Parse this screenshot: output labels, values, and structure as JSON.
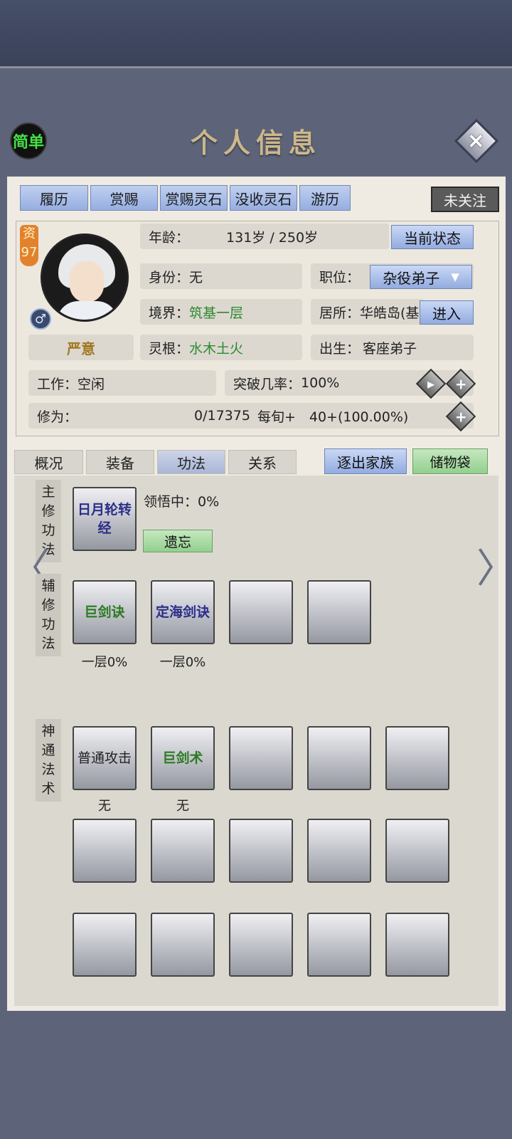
{
  "header": {
    "title": "个人信息",
    "simple_label": "简单",
    "close_icon": "×"
  },
  "top_tabs": [
    "履历",
    "赏赐",
    "赏赐灵石",
    "没收灵石",
    "游历"
  ],
  "follow_label": "未关注",
  "character": {
    "aptitude_label": "资",
    "aptitude_value": "97",
    "gender_symbol": "♂",
    "name": "严意",
    "age_label": "年龄：",
    "age_value": "131岁 / 250岁",
    "current_status_button": "当前状态",
    "identity_label": "身份：",
    "identity_value": "无",
    "position_label": "职位：",
    "position_value": "杂役弟子",
    "position_caret": "▼",
    "realm_label": "境界：",
    "realm_value": "筑基一层",
    "residence_label": "居所：",
    "residence_value": "华皓岛(基",
    "enter_button": "进入",
    "root_label": "灵根：",
    "root_value": "水木土火",
    "birth_label": "出生：",
    "birth_value": "客座弟子",
    "work_label": "工作：",
    "work_value": "空闲",
    "breakthrough_label": "突破几率：",
    "breakthrough_value": "100%",
    "cultivation_label": "修为：",
    "cultivation_value": "0/17375",
    "cultivation_rate": "每旬+　40+(100.00%)"
  },
  "sub_tabs": [
    "概况",
    "装备",
    "功法",
    "关系"
  ],
  "expel_button": "逐出家族",
  "bag_button": "储物袋",
  "main_method": {
    "label": [
      "主",
      "修",
      "功",
      "法"
    ],
    "skill": "日月轮转经",
    "comprehend": "领悟中：0%",
    "forget_button": "遗忘"
  },
  "aux_method": {
    "label": [
      "辅",
      "修",
      "功",
      "法"
    ],
    "slots": [
      {
        "name": "巨剑诀",
        "level": "一层0%"
      },
      {
        "name": "定海剑诀",
        "level": "一层0%"
      }
    ]
  },
  "magic": {
    "label": [
      "神",
      "通",
      "法",
      "术"
    ],
    "slots": [
      {
        "name": "普通攻击",
        "level": "无"
      },
      {
        "name": "巨剑术",
        "level": "无"
      }
    ]
  },
  "nav": {
    "left": "〈",
    "right": "〉"
  },
  "colors": {
    "tab_blue": "#a9bde8",
    "green_text": "#2d8a2d",
    "name_gold": "#a07a22",
    "title_gold": "#cdb78a"
  }
}
